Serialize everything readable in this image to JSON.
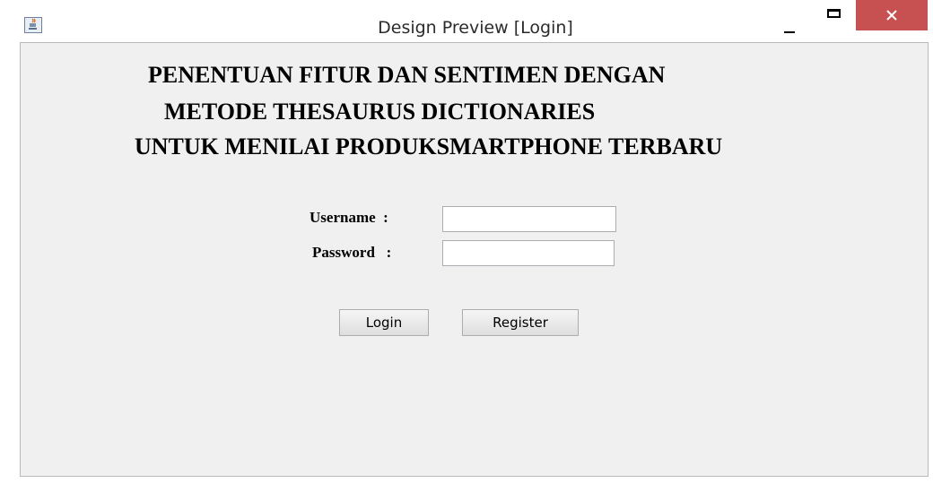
{
  "window": {
    "title": "Design Preview [Login]",
    "controls": {
      "minimize": "minimize-icon",
      "maximize": "maximize-icon",
      "close": "close-icon"
    },
    "close_color": "#c75050",
    "app_icon": "java-cup-icon"
  },
  "heading": {
    "line1": "PENENTUAN FITUR DAN SENTIMEN DENGAN",
    "line2": "METODE THESAURUS DICTIONARIES",
    "line3": "UNTUK MENILAI PRODUKSMARTPHONE TERBARU"
  },
  "form": {
    "username_label": "Username  :",
    "username_value": "",
    "password_label": "Password   :",
    "password_value": ""
  },
  "buttons": {
    "login": "Login",
    "register": "Register"
  }
}
